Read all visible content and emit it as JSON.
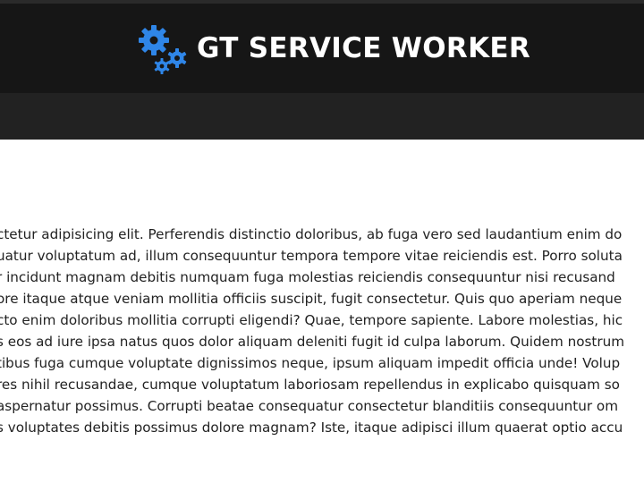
{
  "header": {
    "title": "GT SERVICE WORKER",
    "logo_icon": "gears-icon",
    "accent_color": "#2f86e8"
  },
  "content": {
    "lines": [
      "ctetur adipisicing elit. Perferendis distinctio doloribus, ab fuga vero sed laudantium enim do",
      "uatur voluptatum ad, illum consequuntur tempora tempore vitae reiciendis est. Porro soluta",
      "r incidunt magnam debitis numquam fuga molestias reiciendis consequuntur nisi recusand",
      "ore itaque atque veniam mollitia officiis suscipit, fugit consectetur. Quis quo aperiam neque",
      "cto enim doloribus mollitia corrupti eligendi? Quae, tempore sapiente. Labore molestias, hic",
      "s eos ad iure ipsa natus quos dolor aliquam deleniti fugit id culpa laborum. Quidem nostrum",
      "tibus fuga cumque voluptate dignissimos neque, ipsum aliquam impedit officia unde! Volup",
      "res nihil recusandae, cumque voluptatum laboriosam repellendus in explicabo quisquam so",
      "aspernatur possimus. Corrupti beatae consequatur consectetur blanditiis consequuntur om",
      "s voluptates debitis possimus dolore magnam? Iste, itaque adipisci illum quaerat optio accu"
    ]
  }
}
